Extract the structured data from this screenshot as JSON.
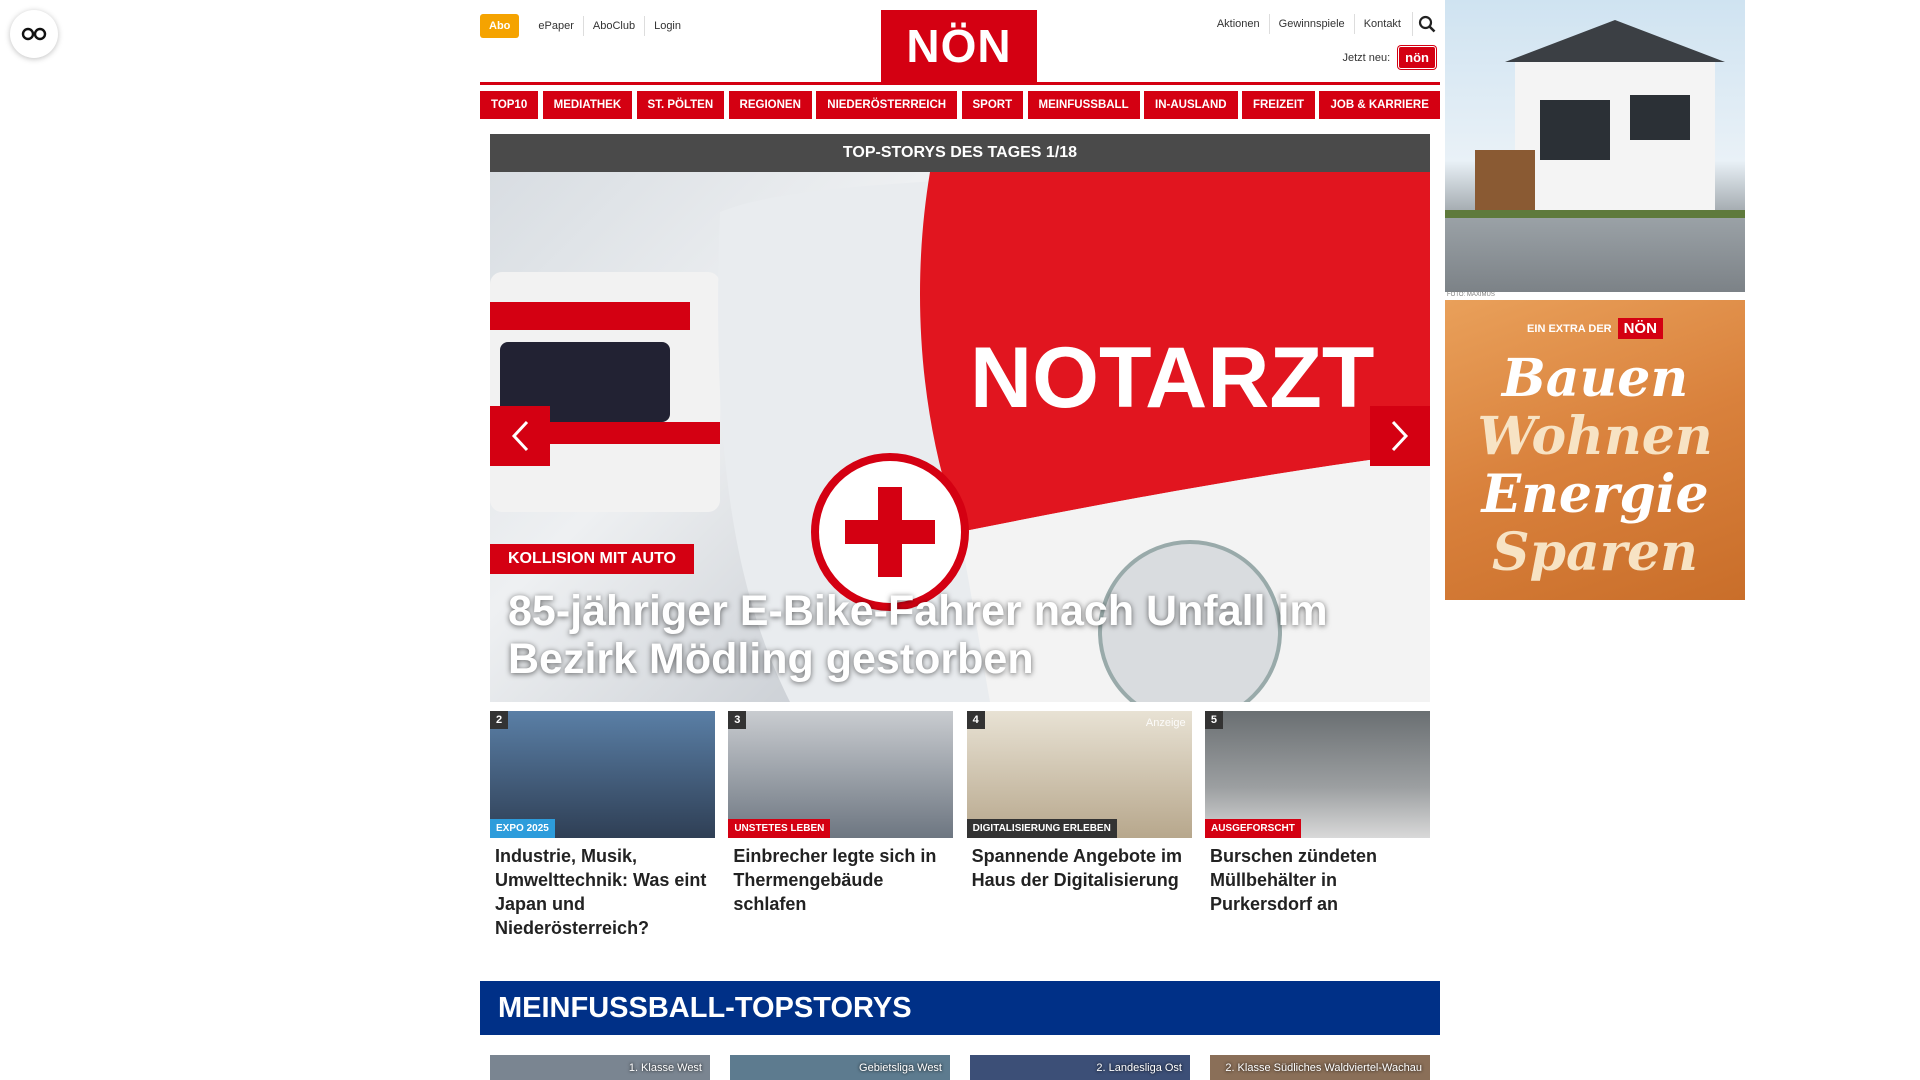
{
  "accessibility": {
    "icon": "glasses-icon"
  },
  "header": {
    "abo_label": "Abo",
    "left_links": [
      "ePaper",
      "AboClub",
      "Login"
    ],
    "logo_text": "NÖN",
    "right_links": [
      "Aktionen",
      "Gewinnspiele",
      "Kontakt"
    ],
    "search_icon": "search-icon",
    "jetzt_label": "Jetzt neu:",
    "jetzt_logo": "nön"
  },
  "nav": {
    "items": [
      "TOP10",
      "MEDIATHEK",
      "ST. PÖLTEN",
      "REGIONEN",
      "NIEDERÖSTERREICH",
      "SPORT",
      "MEINFUSSBALL",
      "IN-AUSLAND",
      "FREIZEIT",
      "JOB & KARRIERE"
    ]
  },
  "slider": {
    "title": "TOP-STORYS DES TAGES 1/18",
    "kicker": "KOLLISION MIT AUTO",
    "headline": "85-jähriger E-Bike-Fahrer nach Unfall im Bezirk Mödling gestorben",
    "vehicle_text": "NOTARZT",
    "prev_icon": "chevron-left-icon",
    "next_icon": "chevron-right-icon"
  },
  "teasers": [
    {
      "num": "2",
      "badge": "EXPO 2025",
      "badge_color": "#2d9cdb",
      "title": "Industrie, Musik, Umwelttechnik: Was eint Japan und Niederösterreich?"
    },
    {
      "num": "3",
      "badge": "UNSTETES LEBEN",
      "badge_color": "#d40012",
      "title": "Einbrecher legte sich in Thermengebäude schlafen"
    },
    {
      "num": "4",
      "badge": "DIGITALISIERUNG ERLEBEN",
      "badge_color": "#333333",
      "anzeige": "Anzeige",
      "title": "Spannende Angebote im Haus der Digitalisierung"
    },
    {
      "num": "5",
      "badge": "AUSGEFORSCHT",
      "badge_color": "#d40012",
      "title": "Burschen zündeten Müllbehälter in Purkersdorf an"
    }
  ],
  "meinfussball": {
    "title": "MEINFUSSBALL-TOPSTORYS",
    "cards": [
      "1. Klasse West",
      "Gebietsliga West",
      "2. Landesliga Ost",
      "2. Klasse Südliches Waldviertel-Wachau"
    ]
  },
  "ads": {
    "house_credit": "FOTO: MAXIMUS",
    "extra_label": "EIN EXTRA DER",
    "extra_logo": "NÖN",
    "words": [
      "Bauen",
      "Wohnen",
      "Energie",
      "Sparen"
    ],
    "word_colors": [
      "#ffffff",
      "#f7e3c4",
      "#ffffff",
      "#f7e3c4"
    ]
  }
}
